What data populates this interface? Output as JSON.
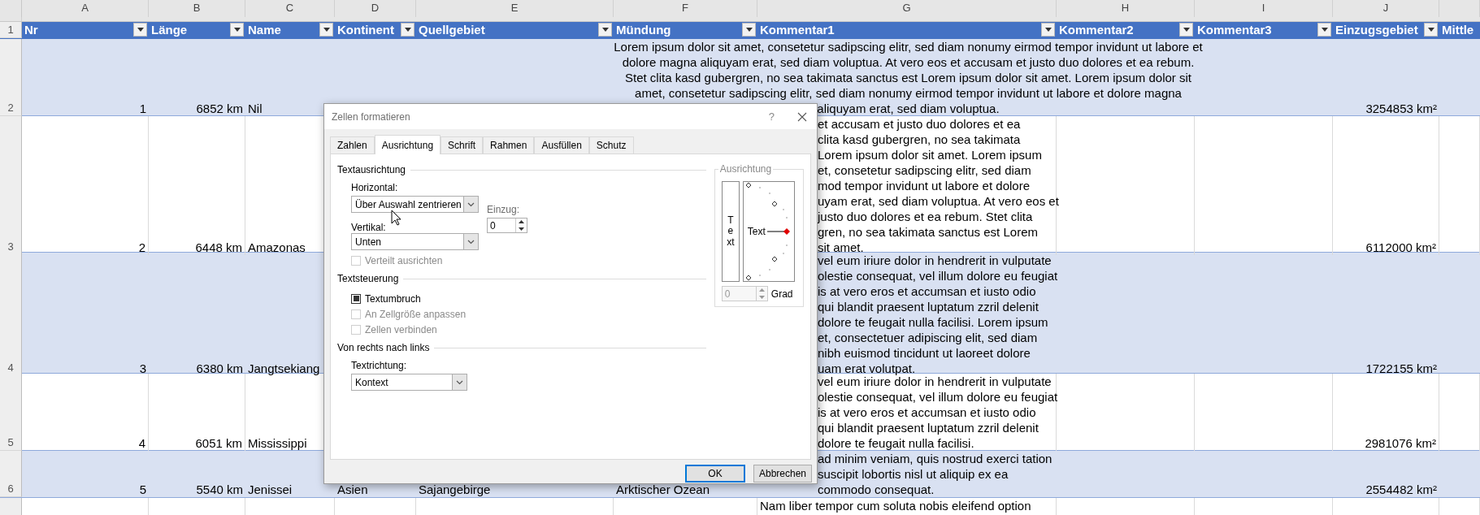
{
  "sheet": {
    "header_row_number": "1",
    "columns": [
      {
        "letter": "A",
        "header": "Nr"
      },
      {
        "letter": "B",
        "header": "Länge"
      },
      {
        "letter": "C",
        "header": "Name"
      },
      {
        "letter": "D",
        "header": "Kontinent"
      },
      {
        "letter": "E",
        "header": "Quellgebiet"
      },
      {
        "letter": "F",
        "header": "Mündung"
      },
      {
        "letter": "G",
        "header": "Kommentar1"
      },
      {
        "letter": "H",
        "header": "Kommentar2"
      },
      {
        "letter": "I",
        "header": "Kommentar3"
      },
      {
        "letter": "J",
        "header": "Einzugsgebiet"
      },
      {
        "header": "Mittle"
      }
    ],
    "rows": [
      {
        "number": "2",
        "banded": true,
        "nr": "1",
        "length": "6852 km",
        "name": "Nil",
        "centered": true,
        "comment": [
          "Lorem ipsum dolor sit amet, consetetur sadipscing elitr, sed diam nonumy eirmod tempor invidunt ut labore et",
          "dolore magna aliquyam erat, sed diam voluptua. At vero eos et accusam et justo duo dolores et ea rebum.",
          "Stet clita kasd gubergren, no sea takimata sanctus est Lorem ipsum dolor sit amet. Lorem ipsum dolor sit",
          "amet, consetetur sadipscing elitr, sed diam nonumy eirmod tempor invidunt ut labore et dolore magna",
          "aliquyam erat, sed diam voluptua."
        ],
        "area": "3254853 km²"
      },
      {
        "number": "3",
        "banded": false,
        "nr": "2",
        "length": "6448 km",
        "name": "Amazonas",
        "centered": false,
        "comment": [
          "et accusam et justo duo dolores et ea",
          "clita kasd gubergren, no sea takimata",
          "Lorem ipsum dolor sit amet. Lorem ipsum",
          "et, consetetur sadipscing elitr, sed diam",
          "mod tempor invidunt ut labore et dolore",
          "uyam erat, sed diam voluptua. At vero eos et",
          "justo duo dolores et ea rebum. Stet clita",
          "gren, no sea takimata sanctus est Lorem",
          "sit amet."
        ],
        "area": "6112000 km²"
      },
      {
        "number": "4",
        "banded": true,
        "nr": "3",
        "length": "6380 km",
        "name": "Jangtsekiang",
        "centered": false,
        "comment": [
          "vel eum iriure dolor in hendrerit in vulputate",
          "olestie consequat, vel illum dolore eu feugiat",
          "is at vero eros et accumsan et iusto odio",
          "qui blandit praesent luptatum zzril delenit",
          "dolore te feugait nulla facilisi. Lorem ipsum",
          "et, consectetuer adipiscing elit, sed diam",
          "nibh euismod tincidunt ut laoreet dolore",
          "uam erat volutpat."
        ],
        "area": "1722155 km²"
      },
      {
        "number": "5",
        "banded": false,
        "nr": "4",
        "length": "6051 km",
        "name": "Mississippi",
        "centered": false,
        "comment": [
          "vel eum iriure dolor in hendrerit in vulputate",
          "olestie consequat, vel illum dolore eu feugiat",
          "is at vero eros et accumsan et iusto odio",
          "qui blandit praesent luptatum zzril delenit",
          "dolore te feugait nulla facilisi."
        ],
        "area": "2981076 km²"
      },
      {
        "number": "6",
        "banded": true,
        "nr": "5",
        "length": "5540 km",
        "name": "Jenissei",
        "continent": "Asien",
        "source": "Sajangebirge",
        "mouth": "Arktischer Ozean",
        "centered": false,
        "comment": [
          "ad minim veniam, quis nostrud exerci tation",
          "suscipit lobortis nisl ut aliquip ex ea",
          "commodo consequat."
        ],
        "area": "2554482 km²"
      },
      {
        "banded": false,
        "centered": false,
        "comment": [
          "Nam liber tempor cum soluta nobis eleifend option"
        ]
      }
    ]
  },
  "dialog": {
    "title": "Zellen formatieren",
    "help": "?",
    "tabs": [
      {
        "label": "Zahlen",
        "selected": false
      },
      {
        "label": "Ausrichtung",
        "selected": true
      },
      {
        "label": "Schrift",
        "selected": false
      },
      {
        "label": "Rahmen",
        "selected": false
      },
      {
        "label": "Ausfüllen",
        "selected": false
      },
      {
        "label": "Schutz",
        "selected": false
      }
    ],
    "text_alignment": {
      "heading": "Textausrichtung",
      "horizontal_label": "Horizontal:",
      "horizontal_value": "Über Auswahl zentrieren",
      "vertical_label": "Vertikal:",
      "vertical_value": "Unten",
      "indent_label": "Einzug:",
      "indent_value": "0",
      "distributed": {
        "label": "Verteilt ausrichten",
        "checked": false,
        "disabled": true
      }
    },
    "text_control": {
      "heading": "Textsteuerung",
      "options": [
        {
          "label": "Textumbruch",
          "checked": true,
          "disabled": false
        },
        {
          "label": "An Zellgröße anpassen",
          "checked": false,
          "disabled": true
        },
        {
          "label": "Zellen verbinden",
          "checked": false,
          "disabled": true
        }
      ]
    },
    "right_to_left": {
      "heading": "Von rechts nach links",
      "direction_label": "Textrichtung:",
      "direction_value": "Kontext"
    },
    "orientation": {
      "heading": "Ausrichtung",
      "vertical_text": "Text",
      "dial_text": "Text",
      "degrees_value": "0",
      "degrees_disabled": true,
      "degrees_label": "Grad"
    },
    "buttons": [
      {
        "label": "OK",
        "default": true
      },
      {
        "label": "Abbrechen",
        "default": false
      }
    ]
  }
}
